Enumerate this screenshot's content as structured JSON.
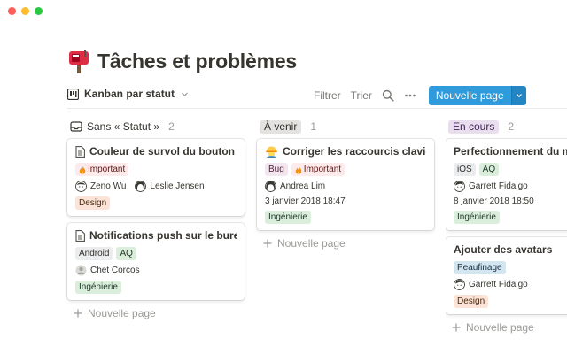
{
  "window": {
    "traffic": [
      "#fe5f57",
      "#febc2e",
      "#28c840"
    ]
  },
  "page": {
    "title": "Tâches et problèmes",
    "icon": "mailbox-icon"
  },
  "toolbar": {
    "view_label": "Kanban par statut",
    "filter_label": "Filtrer",
    "sort_label": "Trier",
    "new_label": "Nouvelle page"
  },
  "tag_colors": {
    "Important": "#fdebec",
    "Design": "#fbe4d7",
    "Android": "#ebeced",
    "AQ": "#dbeddb",
    "Ingénierie": "#dbeddb",
    "Bug": "#f4e6ef",
    "iOS": "#ebeced",
    "Peaufinage": "#d3e5ef"
  },
  "columns": [
    {
      "label": "Sans « Statut »",
      "count": "2",
      "cards": [
        {
          "title": "Couleur de survol du bouton bleu",
          "tags": [
            "Important"
          ],
          "people": [
            "Zeno Wu",
            "Leslie Jensen"
          ],
          "date": "",
          "tags2": [
            "Design"
          ]
        },
        {
          "title": "Notifications push sur le bureau",
          "tags": [
            "Android",
            "AQ"
          ],
          "people": [
            "Chet Corcos"
          ],
          "date": "",
          "tags2": [
            "Ingénierie"
          ]
        }
      ],
      "add_label": "Nouvelle page"
    },
    {
      "label": "À venir",
      "count": "1",
      "label_bg": "#e3e2e0",
      "cards": [
        {
          "title": "Corriger les raccourcis clavier",
          "tags": [
            "Bug",
            "Important"
          ],
          "people": [
            "Andrea Lim"
          ],
          "date": "3 janvier 2018 18:47",
          "tags2": [
            "Ingénierie"
          ]
        }
      ],
      "add_label": "Nouvelle page"
    },
    {
      "label": "En cours",
      "count": "2",
      "label_bg": "#e8deee",
      "cards": [
        {
          "title": "Perfectionnement du mors l",
          "tags": [
            "iOS",
            "AQ"
          ],
          "people": [
            "Garrett Fidalgo"
          ],
          "date": "8 janvier 2018 18:50",
          "tags2": [
            "Ingénierie"
          ]
        },
        {
          "title": "Ajouter des avatars",
          "tags": [
            "Peaufinage"
          ],
          "people": [
            "Garrett Fidalgo"
          ],
          "date": "",
          "tags2": [
            "Design"
          ]
        }
      ],
      "add_label": "Nouvelle page"
    }
  ]
}
